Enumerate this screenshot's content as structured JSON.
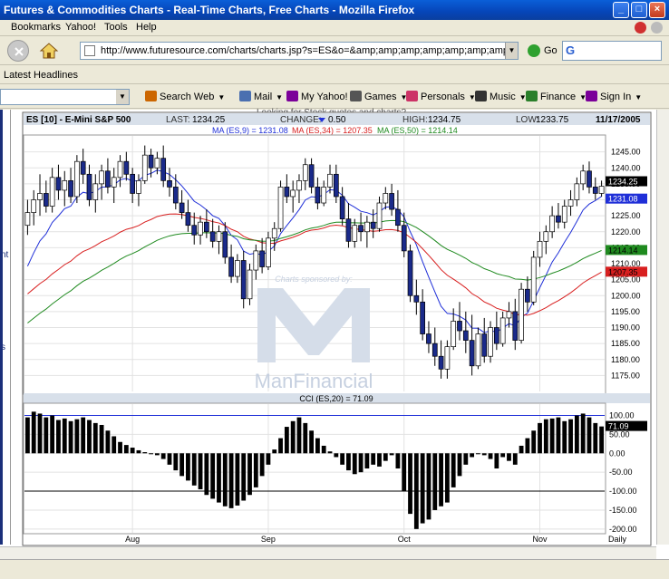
{
  "window": {
    "title": "Futures & Commodities Charts - Real-Time Charts, Free Charts - Mozilla Firefox"
  },
  "menu": {
    "items": [
      "Bookmarks",
      "Yahoo!",
      "Tools",
      "Help"
    ]
  },
  "nav": {
    "url": "http://www.futuresource.com/charts/charts.jsp?s=ES&o=&amp;amp;amp;amp;amp;amp;amp;amp;amp;a=D&",
    "go_label": "Go"
  },
  "headlines": {
    "label": "Latest Headlines"
  },
  "yahoo_toolbar": {
    "items": [
      {
        "label": "Search Web",
        "icon": "search-web-icon",
        "color": "#cc6600",
        "dropdown": true
      },
      {
        "label": "Mail",
        "icon": "mail-icon",
        "color": "#4a6fb0",
        "dropdown": true
      },
      {
        "label": "My Yahoo!",
        "icon": "my-yahoo-icon",
        "color": "#7b0099",
        "dropdown": false
      },
      {
        "label": "Games",
        "icon": "games-icon",
        "color": "#555555",
        "dropdown": true
      },
      {
        "label": "Personals",
        "icon": "personals-icon",
        "color": "#cc3366",
        "dropdown": true
      },
      {
        "label": "Music",
        "icon": "music-icon",
        "color": "#333333",
        "dropdown": true
      },
      {
        "label": "Finance",
        "icon": "finance-icon",
        "color": "#2a7f2a",
        "dropdown": true
      },
      {
        "label": "Sign In",
        "icon": "sign-in-icon",
        "color": "#7b0099",
        "dropdown": true
      }
    ]
  },
  "page_snippet": "Looking for Stock quotes and charts?",
  "left_frame_text": [
    "nt",
    "s"
  ],
  "chart_header": {
    "symbol": "ES [10] - E-Mini S&P 500",
    "last_label": "LAST:",
    "last": "1234.25",
    "change_label": "CHANGE:",
    "change": "0.50",
    "high_label": "HIGH:",
    "high": "1234.75",
    "low_label": "LOW:",
    "low": "1233.75",
    "date": "11/17/2005",
    "ma_labels": [
      {
        "text": "MA (ES,9) = 1231.08",
        "color": "#1f2fd8"
      },
      {
        "text": "MA (ES,34) = 1207.35",
        "color": "#d81f1f"
      },
      {
        "text": "MA (ES,50) = 1214.14",
        "color": "#1f8a1f"
      }
    ],
    "cci_label": "CCI (ES,20) = 71.09",
    "sponsor_text": "Charts sponsored by:",
    "sponsor_name": "ManFinancial",
    "period_label": "Daily"
  },
  "chart_data": [
    {
      "type": "candlestick",
      "ylim": [
        1170,
        1250
      ],
      "y_ticks": [
        1175,
        1180,
        1185,
        1190,
        1195,
        1200,
        1205,
        1210,
        1215,
        1220,
        1225,
        1230,
        1235,
        1240,
        1245
      ],
      "x_ticks": [
        {
          "label": "Aug",
          "bar": 17
        },
        {
          "label": "Sep",
          "bar": 39
        },
        {
          "label": "Oct",
          "bar": 61
        },
        {
          "label": "Nov",
          "bar": 83
        }
      ],
      "grid": true,
      "ohlc": [
        [
          1222,
          1230,
          1219,
          1226
        ],
        [
          1226,
          1233,
          1222,
          1230
        ],
        [
          1230,
          1238,
          1225,
          1232
        ],
        [
          1232,
          1236,
          1226,
          1228
        ],
        [
          1228,
          1240,
          1226,
          1237
        ],
        [
          1237,
          1241,
          1230,
          1233
        ],
        [
          1233,
          1239,
          1228,
          1236
        ],
        [
          1236,
          1240,
          1229,
          1231
        ],
        [
          1231,
          1244,
          1229,
          1242
        ],
        [
          1242,
          1246,
          1235,
          1238
        ],
        [
          1238,
          1241,
          1228,
          1230
        ],
        [
          1230,
          1238,
          1226,
          1235
        ],
        [
          1235,
          1241,
          1230,
          1239
        ],
        [
          1239,
          1243,
          1232,
          1234
        ],
        [
          1234,
          1240,
          1229,
          1237
        ],
        [
          1237,
          1244,
          1234,
          1242
        ],
        [
          1242,
          1245,
          1236,
          1238
        ],
        [
          1238,
          1240,
          1229,
          1232
        ],
        [
          1232,
          1238,
          1228,
          1236
        ],
        [
          1236,
          1247,
          1235,
          1244
        ],
        [
          1244,
          1246,
          1237,
          1240
        ],
        [
          1240,
          1245,
          1238,
          1243
        ],
        [
          1243,
          1247,
          1234,
          1236
        ],
        [
          1236,
          1240,
          1231,
          1234
        ],
        [
          1234,
          1238,
          1227,
          1229
        ],
        [
          1229,
          1233,
          1224,
          1226
        ],
        [
          1226,
          1230,
          1220,
          1222
        ],
        [
          1222,
          1226,
          1216,
          1219
        ],
        [
          1219,
          1225,
          1216,
          1223
        ],
        [
          1223,
          1227,
          1218,
          1220
        ],
        [
          1220,
          1224,
          1215,
          1217
        ],
        [
          1217,
          1222,
          1213,
          1220
        ],
        [
          1220,
          1223,
          1210,
          1212
        ],
        [
          1212,
          1216,
          1204,
          1206
        ],
        [
          1206,
          1213,
          1204,
          1211
        ],
        [
          1211,
          1214,
          1196,
          1199
        ],
        [
          1199,
          1210,
          1197,
          1208
        ],
        [
          1208,
          1216,
          1205,
          1214
        ],
        [
          1214,
          1218,
          1207,
          1209
        ],
        [
          1209,
          1220,
          1208,
          1218
        ],
        [
          1218,
          1223,
          1214,
          1221
        ],
        [
          1221,
          1236,
          1220,
          1234
        ],
        [
          1234,
          1238,
          1229,
          1231
        ],
        [
          1231,
          1236,
          1226,
          1233
        ],
        [
          1233,
          1238,
          1229,
          1236
        ],
        [
          1236,
          1243,
          1233,
          1241
        ],
        [
          1241,
          1243,
          1232,
          1234
        ],
        [
          1234,
          1237,
          1227,
          1229
        ],
        [
          1229,
          1236,
          1228,
          1234
        ],
        [
          1234,
          1241,
          1232,
          1238
        ],
        [
          1238,
          1241,
          1229,
          1231
        ],
        [
          1231,
          1234,
          1222,
          1224
        ],
        [
          1224,
          1229,
          1215,
          1217
        ],
        [
          1217,
          1224,
          1215,
          1222
        ],
        [
          1222,
          1226,
          1217,
          1220
        ],
        [
          1220,
          1225,
          1215,
          1223
        ],
        [
          1223,
          1227,
          1218,
          1221
        ],
        [
          1221,
          1231,
          1220,
          1229
        ],
        [
          1229,
          1234,
          1227,
          1232
        ],
        [
          1232,
          1235,
          1225,
          1227
        ],
        [
          1227,
          1233,
          1220,
          1222
        ],
        [
          1222,
          1226,
          1212,
          1214
        ],
        [
          1214,
          1216,
          1198,
          1200
        ],
        [
          1200,
          1205,
          1194,
          1198
        ],
        [
          1198,
          1202,
          1186,
          1188
        ],
        [
          1188,
          1192,
          1182,
          1185
        ],
        [
          1185,
          1190,
          1178,
          1181
        ],
        [
          1181,
          1186,
          1174,
          1177
        ],
        [
          1177,
          1186,
          1174,
          1184
        ],
        [
          1184,
          1196,
          1183,
          1192
        ],
        [
          1192,
          1198,
          1186,
          1189
        ],
        [
          1189,
          1195,
          1182,
          1186
        ],
        [
          1186,
          1194,
          1175,
          1178
        ],
        [
          1178,
          1190,
          1177,
          1188
        ],
        [
          1188,
          1193,
          1179,
          1181
        ],
        [
          1181,
          1192,
          1179,
          1190
        ],
        [
          1190,
          1195,
          1183,
          1185
        ],
        [
          1185,
          1195,
          1184,
          1193
        ],
        [
          1193,
          1198,
          1190,
          1195
        ],
        [
          1195,
          1199,
          1183,
          1186
        ],
        [
          1186,
          1204,
          1185,
          1202
        ],
        [
          1202,
          1206,
          1195,
          1198
        ],
        [
          1198,
          1214,
          1197,
          1212
        ],
        [
          1212,
          1220,
          1209,
          1217
        ],
        [
          1217,
          1222,
          1213,
          1220
        ],
        [
          1220,
          1228,
          1218,
          1225
        ],
        [
          1225,
          1229,
          1221,
          1223
        ],
        [
          1223,
          1230,
          1221,
          1228
        ],
        [
          1228,
          1233,
          1225,
          1230
        ],
        [
          1230,
          1237,
          1228,
          1235
        ],
        [
          1235,
          1241,
          1233,
          1239
        ],
        [
          1239,
          1242,
          1232,
          1234
        ],
        [
          1234,
          1237,
          1230,
          1232
        ],
        [
          1232,
          1236,
          1231,
          1234.25
        ]
      ],
      "series": [
        {
          "name": "MA (ES,9)",
          "color": "#1f2fd8",
          "last": 1231.08
        },
        {
          "name": "MA (ES,34)",
          "color": "#d81f1f",
          "last": 1207.35
        },
        {
          "name": "MA (ES,50)",
          "color": "#1f8a1f",
          "last": 1214.14
        }
      ],
      "ma_start": [
        1205,
        1199,
        1190
      ],
      "last_value_tags": [
        {
          "value": "1234.25",
          "bg": "#000000",
          "fg": "#ffffff"
        },
        {
          "value": "1231.08",
          "bg": "#1f2fd8",
          "fg": "#ffffff"
        },
        {
          "value": "1214.14",
          "bg": "#1f8a1f",
          "fg": "#000000"
        },
        {
          "value": "1207.35",
          "bg": "#d81f1f",
          "fg": "#000000"
        }
      ]
    },
    {
      "type": "bar",
      "name": "CCI (ES,20)",
      "ylim": [
        -210,
        130
      ],
      "y_ticks": [
        100,
        50,
        0,
        -50,
        -100,
        -150,
        -200
      ],
      "y_tick_labels": [
        "100.00",
        "50.00",
        "0.00",
        "-50.00",
        "-100.00",
        "-150.00",
        "-200.00"
      ],
      "ref_lines": [
        {
          "value": 100,
          "color": "#1f2fd8"
        },
        {
          "value": -100,
          "color": "#000000"
        }
      ],
      "last": "71.09",
      "values": [
        95,
        110,
        105,
        95,
        100,
        88,
        92,
        85,
        90,
        95,
        88,
        80,
        75,
        60,
        45,
        30,
        22,
        15,
        8,
        3,
        0,
        -5,
        -15,
        -30,
        -45,
        -60,
        -72,
        -85,
        -95,
        -110,
        -120,
        -130,
        -140,
        -145,
        -138,
        -125,
        -110,
        -90,
        -60,
        -30,
        10,
        40,
        70,
        85,
        95,
        80,
        60,
        40,
        20,
        5,
        -10,
        -30,
        -45,
        -55,
        -50,
        -40,
        -30,
        -35,
        -20,
        -5,
        -40,
        -100,
        -160,
        -200,
        -185,
        -175,
        -150,
        -140,
        -130,
        -90,
        -60,
        -30,
        -10,
        0,
        -5,
        -15,
        -40,
        -10,
        -20,
        -30,
        20,
        40,
        60,
        80,
        90,
        92,
        95,
        85,
        90,
        100,
        105,
        95,
        80,
        71
      ]
    }
  ]
}
